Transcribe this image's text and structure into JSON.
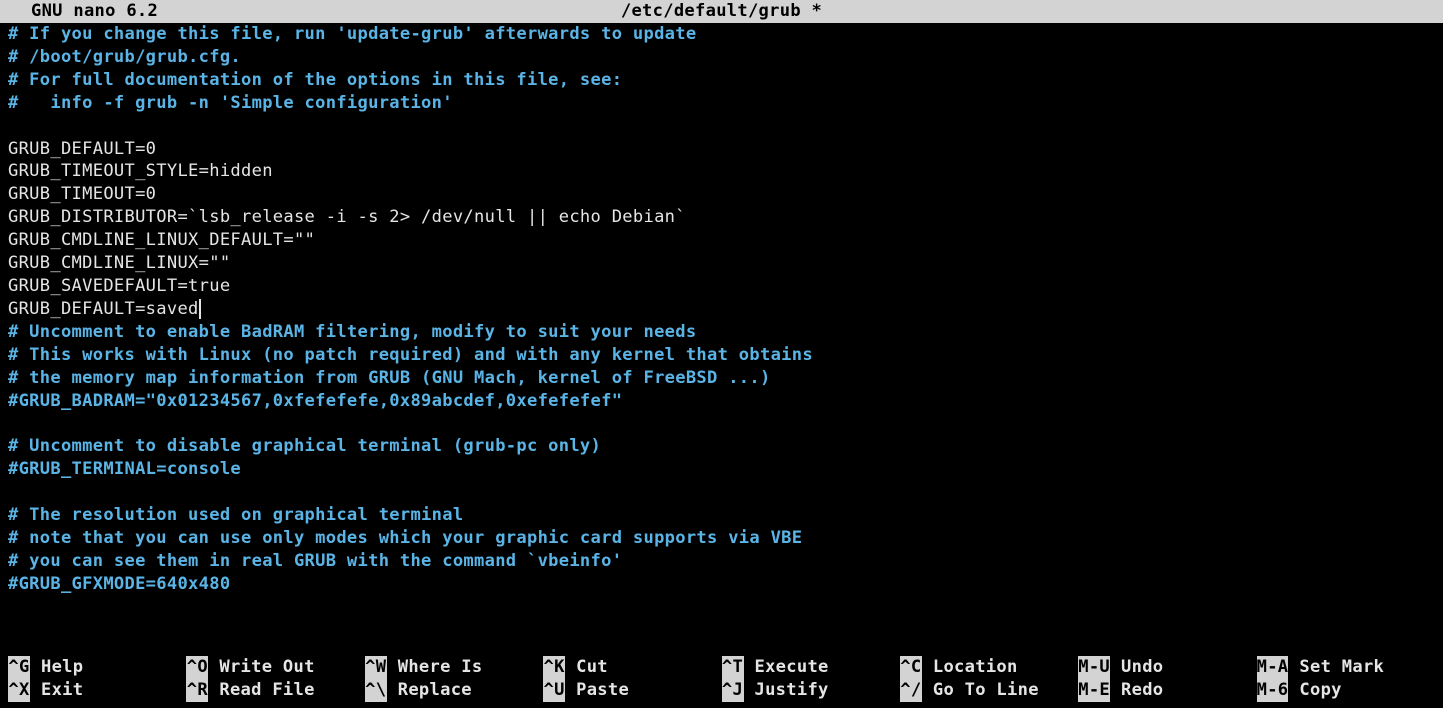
{
  "title": {
    "app": "GNU nano 6.2",
    "filename": "/etc/default/grub *"
  },
  "content": {
    "lines": [
      {
        "text": "# If you change this file, run 'update-grub' afterwards to update",
        "type": "comment"
      },
      {
        "text": "# /boot/grub/grub.cfg.",
        "type": "comment"
      },
      {
        "text": "# For full documentation of the options in this file, see:",
        "type": "comment"
      },
      {
        "text": "#   info -f grub -n 'Simple configuration'",
        "type": "comment"
      },
      {
        "text": "",
        "type": "empty"
      },
      {
        "text": "GRUB_DEFAULT=0",
        "type": "normal"
      },
      {
        "text": "GRUB_TIMEOUT_STYLE=hidden",
        "type": "normal"
      },
      {
        "text": "GRUB_TIMEOUT=0",
        "type": "normal"
      },
      {
        "text": "GRUB_DISTRIBUTOR=`lsb_release -i -s 2> /dev/null || echo Debian`",
        "type": "normal"
      },
      {
        "text": "GRUB_CMDLINE_LINUX_DEFAULT=\"\"",
        "type": "normal"
      },
      {
        "text": "GRUB_CMDLINE_LINUX=\"\"",
        "type": "normal"
      },
      {
        "text": "GRUB_SAVEDEFAULT=true",
        "type": "normal"
      },
      {
        "text": "GRUB_DEFAULT=saved",
        "type": "normal",
        "cursor": true
      },
      {
        "text": "# Uncomment to enable BadRAM filtering, modify to suit your needs",
        "type": "comment"
      },
      {
        "text": "# This works with Linux (no patch required) and with any kernel that obtains",
        "type": "comment"
      },
      {
        "text": "# the memory map information from GRUB (GNU Mach, kernel of FreeBSD ...)",
        "type": "comment"
      },
      {
        "text": "#GRUB_BADRAM=\"0x01234567,0xfefefefe,0x89abcdef,0xefefefef\"",
        "type": "comment"
      },
      {
        "text": "",
        "type": "empty"
      },
      {
        "text": "# Uncomment to disable graphical terminal (grub-pc only)",
        "type": "comment"
      },
      {
        "text": "#GRUB_TERMINAL=console",
        "type": "comment"
      },
      {
        "text": "",
        "type": "empty"
      },
      {
        "text": "# The resolution used on graphical terminal",
        "type": "comment"
      },
      {
        "text": "# note that you can use only modes which your graphic card supports via VBE",
        "type": "comment"
      },
      {
        "text": "# you can see them in real GRUB with the command `vbeinfo'",
        "type": "comment"
      },
      {
        "text": "#GRUB_GFXMODE=640x480",
        "type": "comment"
      }
    ]
  },
  "shortcuts": {
    "row1": [
      {
        "key": "^G",
        "label": "Help"
      },
      {
        "key": "^O",
        "label": "Write Out"
      },
      {
        "key": "^W",
        "label": "Where Is"
      },
      {
        "key": "^K",
        "label": "Cut"
      },
      {
        "key": "^T",
        "label": "Execute"
      },
      {
        "key": "^C",
        "label": "Location"
      },
      {
        "key": "M-U",
        "label": "Undo"
      },
      {
        "key": "M-A",
        "label": "Set Mark"
      }
    ],
    "row2": [
      {
        "key": "^X",
        "label": "Exit"
      },
      {
        "key": "^R",
        "label": "Read File"
      },
      {
        "key": "^\\",
        "label": "Replace"
      },
      {
        "key": "^U",
        "label": "Paste"
      },
      {
        "key": "^J",
        "label": "Justify"
      },
      {
        "key": "^/",
        "label": "Go To Line"
      },
      {
        "key": "M-E",
        "label": "Redo"
      },
      {
        "key": "M-6",
        "label": "Copy"
      }
    ]
  }
}
